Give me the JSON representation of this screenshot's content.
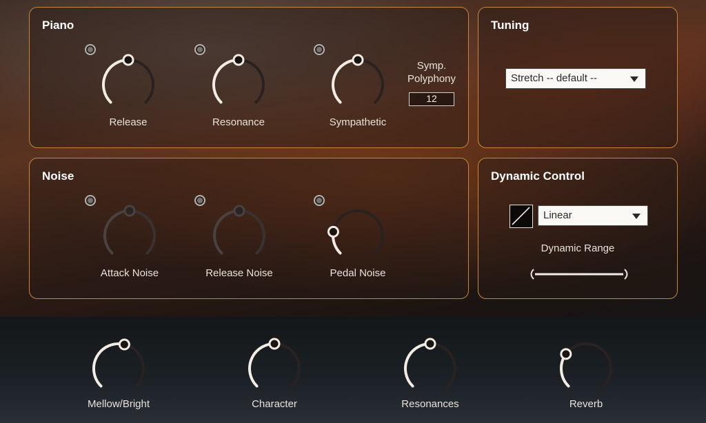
{
  "piano": {
    "title": "Piano",
    "knobs": [
      {
        "label": "Release",
        "value": 0.5,
        "enabled": true
      },
      {
        "label": "Resonance",
        "value": 0.5,
        "enabled": true
      },
      {
        "label": "Sympathetic",
        "value": 0.5,
        "enabled": true
      }
    ],
    "symp_polyphony": {
      "label": "Symp.\nPolyphony",
      "line1": "Symp.",
      "line2": "Polyphony",
      "value": "12"
    }
  },
  "tuning": {
    "title": "Tuning",
    "dropdown_value": "Stretch -- default --"
  },
  "noise": {
    "title": "Noise",
    "knobs": [
      {
        "label": "Attack Noise",
        "value": 0.5,
        "enabled": false
      },
      {
        "label": "Release Noise",
        "value": 0.5,
        "enabled": false
      },
      {
        "label": "Pedal Noise",
        "value": 0.2,
        "enabled": true
      }
    ]
  },
  "dynamic_control": {
    "title": "Dynamic Control",
    "curve_value": "Linear",
    "range_label": "Dynamic Range"
  },
  "bottom_knobs": [
    {
      "label": "Mellow/Bright",
      "value": 0.55
    },
    {
      "label": "Character",
      "value": 0.5
    },
    {
      "label": "Resonances",
      "value": 0.5
    },
    {
      "label": "Reverb",
      "value": 0.3
    }
  ],
  "colors": {
    "accent_border": "#c8863a",
    "knob_active": "#f2ece4",
    "knob_track": "#2a2220"
  }
}
